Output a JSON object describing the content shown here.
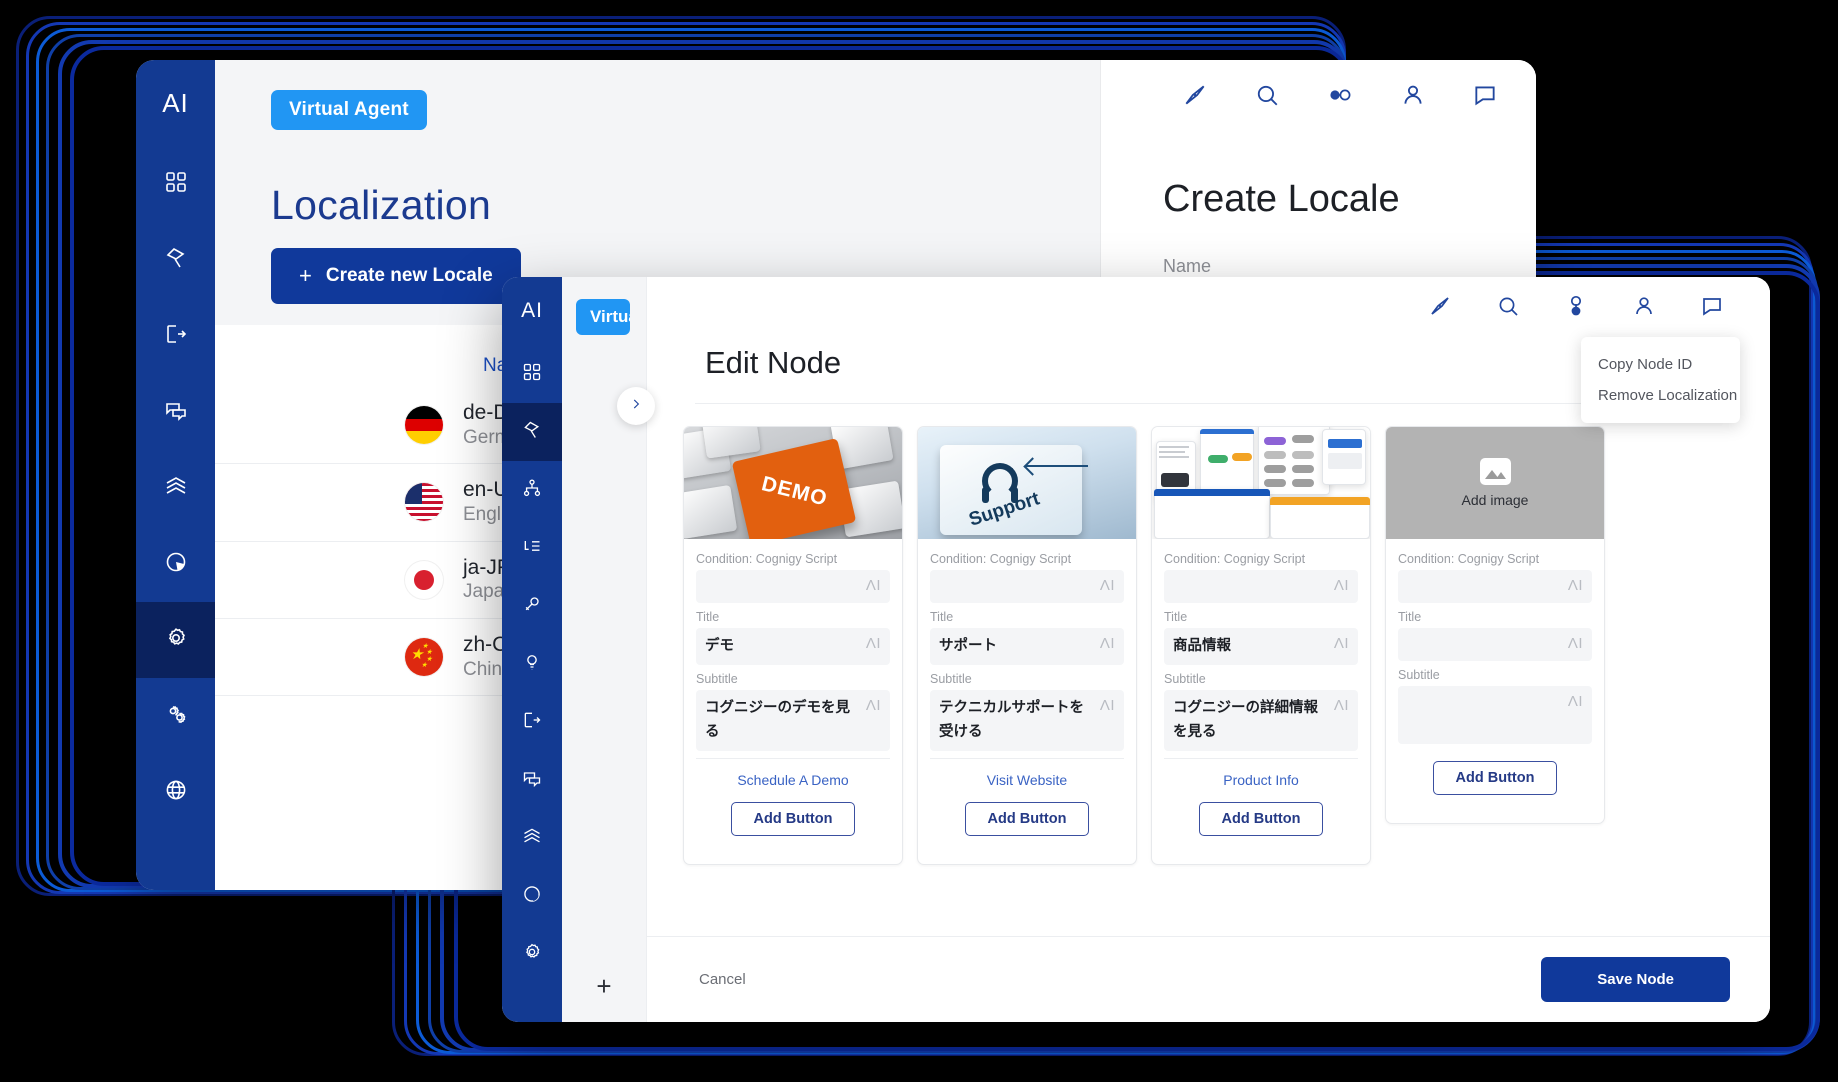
{
  "colors": {
    "brand_navy": "#133a92",
    "brand_dark_navy": "#0b225e",
    "accent_blue": "#2196f3",
    "button_blue": "#10399b",
    "link_blue": "#3a63c4",
    "placeholder_grey": "#9a9da3"
  },
  "window1": {
    "logo": "AI",
    "badge": "Virtual Agent",
    "page_title": "Localization",
    "create_button": {
      "plus": "+",
      "label": "Create new Locale"
    },
    "rail_icons": [
      "grid-icon",
      "flow-icon",
      "exit-icon",
      "conversations-icon",
      "layers-icon",
      "analytics-icon",
      "gear-icon",
      "integrations-icon",
      "globe-icon"
    ],
    "rail_active_index": 6,
    "header_icons": [
      "compass-icon",
      "search-icon",
      "toggle-icon",
      "person-icon",
      "chat-icon"
    ],
    "list": {
      "column_header": "Name",
      "sort": "ascending",
      "rows": [
        {
          "code": "de-DE",
          "language": "German",
          "flag": "de"
        },
        {
          "code": "en-US",
          "language": "English (US)",
          "flag": "us"
        },
        {
          "code": "ja-JP",
          "language": "Japanese",
          "flag": "jp"
        },
        {
          "code": "zh-CN",
          "language": "Chinese",
          "flag": "cn"
        }
      ]
    },
    "panel": {
      "title": "Create Locale",
      "name_label": "Name"
    }
  },
  "window2": {
    "logo": "AI",
    "badge": "Virtual Agent",
    "plus": "+",
    "title": "Edit Node",
    "rail_icons": [
      "grid-icon",
      "flow-icon",
      "hierarchy-icon",
      "lexicon-icon",
      "plugin-icon",
      "insights-icon",
      "exit-icon",
      "conversations-icon",
      "layers-icon",
      "analytics-icon",
      "gear-icon"
    ],
    "rail_active_index": 1,
    "header_icons": [
      "compass-icon",
      "search-icon",
      "toggle-icon",
      "person-icon",
      "chat-icon"
    ],
    "context_menu": {
      "items": [
        "Copy Node ID",
        "Remove Localization"
      ]
    },
    "field_labels": {
      "condition": "Condition: Cognigy Script",
      "title": "Title",
      "subtitle": "Subtitle"
    },
    "ai_mark": "ΛI",
    "add_button_label": "Add Button",
    "add_image_label": "Add image",
    "cards": [
      {
        "image": "demo-keyboard-image",
        "image_text": "DEMO",
        "condition": "",
        "title": "デモ",
        "subtitle": "コグニジーのデモを見る",
        "link": "Schedule A Demo"
      },
      {
        "image": "support-keyboard-image",
        "image_text": "Support",
        "condition": "",
        "title": "サポート",
        "subtitle": "テクニカルサポートを受ける",
        "link": "Visit Website"
      },
      {
        "image": "product-screens-image",
        "image_text": "",
        "condition": "",
        "title": "商品情報",
        "subtitle": "コグニジーの詳細情報を見る",
        "link": "Product Info"
      },
      {
        "image": "empty-image-placeholder",
        "image_text": "Add image",
        "condition": "",
        "title": "",
        "subtitle": "",
        "link": ""
      }
    ],
    "footer": {
      "cancel_label": "Cancel",
      "save_label": "Save Node"
    }
  }
}
